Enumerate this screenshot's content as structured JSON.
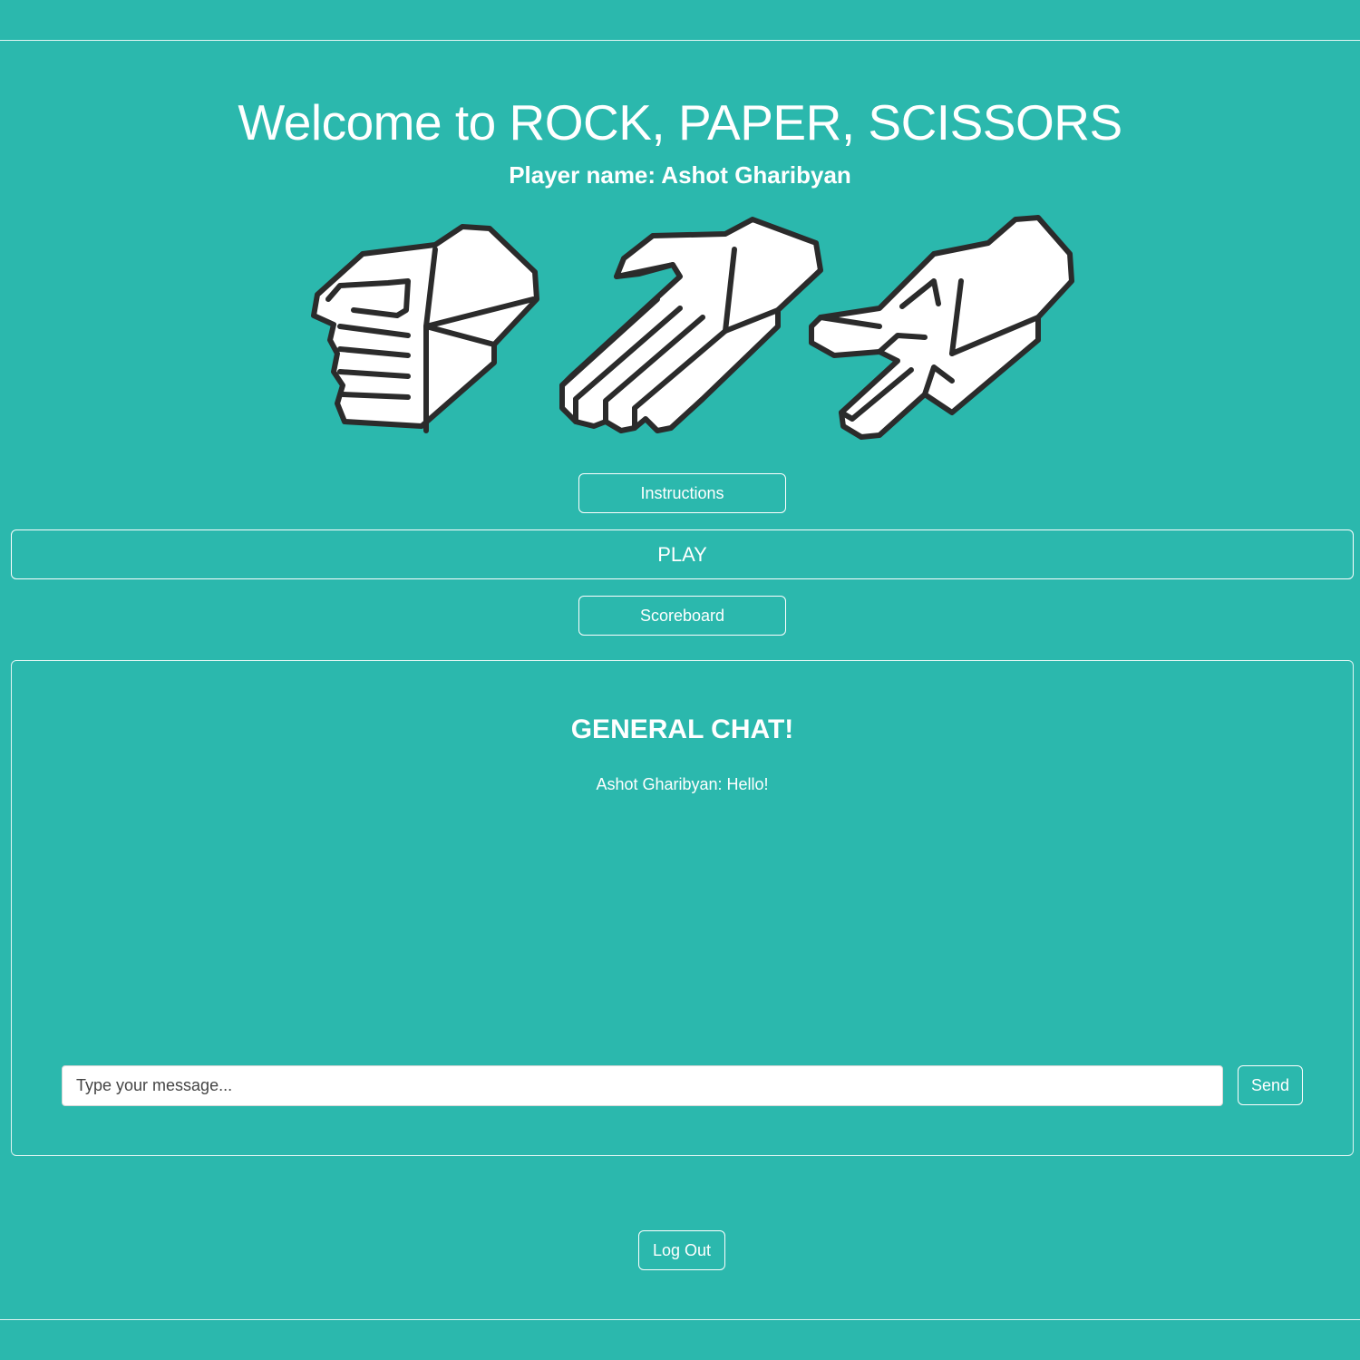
{
  "header": {
    "title": "Welcome to ROCK, PAPER, SCISSORS",
    "player_line": "Player name: Ashot Gharibyan"
  },
  "illustration": {
    "icons": [
      "rock-hand-icon",
      "paper-hand-icon",
      "scissors-hand-icon"
    ]
  },
  "menu": {
    "instructions_label": "Instructions",
    "play_label": "PLAY",
    "scoreboard_label": "Scoreboard"
  },
  "chat": {
    "title": "GENERAL CHAT!",
    "messages": [
      {
        "text": "Ashot Gharibyan: Hello!"
      }
    ],
    "input_placeholder": "Type your message...",
    "input_value": "",
    "send_label": "Send"
  },
  "footer": {
    "logout_label": "Log Out"
  },
  "colors": {
    "background": "#2bb8ad",
    "foreground": "#ffffff",
    "hand_outline": "#2b2b2b",
    "hand_fill": "#ffffff",
    "hand_shade": "#ececec"
  }
}
